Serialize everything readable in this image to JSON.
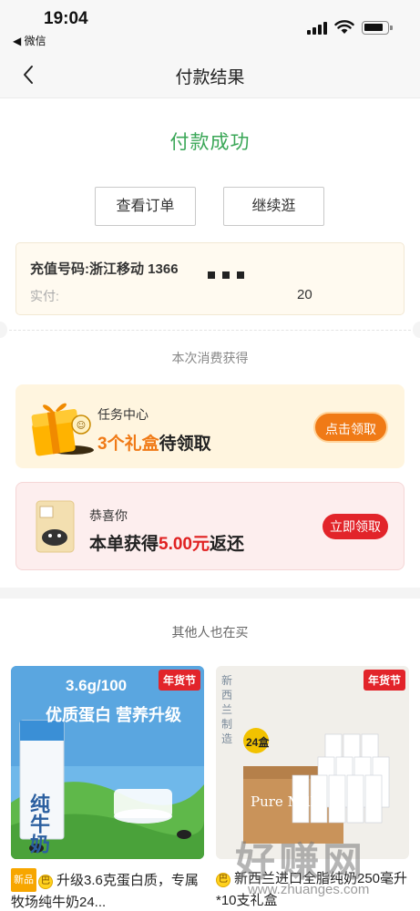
{
  "status_bar": {
    "time": "19:04",
    "back_app": "◀ 微信",
    "icons": [
      "signal-icon",
      "wifi-icon",
      "battery-icon"
    ]
  },
  "nav": {
    "title": "付款结果",
    "back_icon": "chevron-left-icon"
  },
  "result": {
    "status_text": "付款成功",
    "status_color": "#3aa757",
    "buttons": {
      "view_orders": "查看订单",
      "continue_shopping": "继续逛"
    },
    "recharge": {
      "number_label": "充值号码:浙江移动 1366",
      "paid_label": "实付:",
      "paid_value": "20"
    }
  },
  "rewards": {
    "section_title": "本次消费获得",
    "task": {
      "title": "任务中心",
      "count_text": "3个礼盒",
      "suffix_text": "待领取",
      "button": "点击领取",
      "accent_color": "#f07a16"
    },
    "cashback": {
      "title": "恭喜你",
      "prefix_text": "本单获得",
      "amount_text": "5.00元",
      "suffix_text": "返还",
      "button": "立即领取",
      "accent_color": "#e2242a"
    }
  },
  "recommendations": {
    "title": "其他人也在买",
    "products": [
      {
        "badge": "年货节",
        "image_text_1": "3.6g/100",
        "image_text_2": "优质蛋白 营养升级",
        "image_text_3": "纯牛奶",
        "tag_new": "新品",
        "tag_circle": "巴",
        "name": "升级3.6克蛋白质，专属牧场纯牛奶24..."
      },
      {
        "badge": "年货节",
        "image_text_1": "新西兰制造",
        "image_text_2": "24盒",
        "image_text_3": "Pure Milk",
        "tag_circle": "巴",
        "name": "新西兰进口全脂纯奶250毫升*10支礼盒"
      }
    ]
  },
  "watermark": {
    "main": "好赚网",
    "url": "www.zhuanges.com"
  }
}
